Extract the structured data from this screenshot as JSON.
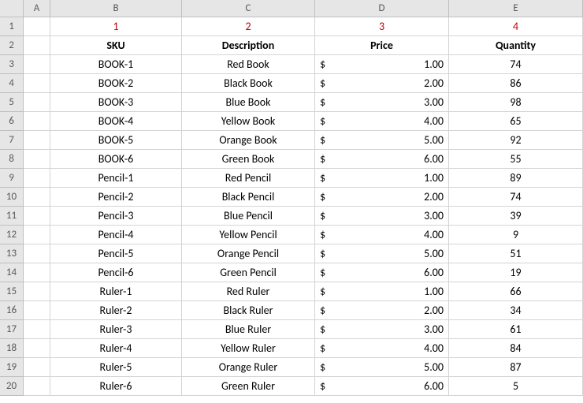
{
  "columns": [
    "A",
    "B",
    "C",
    "D",
    "E"
  ],
  "row_numbers": [
    "1",
    "2",
    "3",
    "4",
    "5",
    "6",
    "7",
    "8",
    "9",
    "10",
    "11",
    "12",
    "13",
    "14",
    "15",
    "16",
    "17",
    "18",
    "19",
    "20"
  ],
  "row1": {
    "B": "1",
    "C": "2",
    "D": "3",
    "E": "4"
  },
  "headers": {
    "B": "SKU",
    "C": "Description",
    "D": "Price",
    "E": "Quantity"
  },
  "currency_symbol": "$",
  "rows": [
    {
      "sku": "BOOK-1",
      "desc": "Red Book",
      "price": "1.00",
      "qty": "74"
    },
    {
      "sku": "BOOK-2",
      "desc": "Black Book",
      "price": "2.00",
      "qty": "86"
    },
    {
      "sku": "BOOK-3",
      "desc": "Blue Book",
      "price": "3.00",
      "qty": "98"
    },
    {
      "sku": "BOOK-4",
      "desc": "Yellow Book",
      "price": "4.00",
      "qty": "65"
    },
    {
      "sku": "BOOK-5",
      "desc": "Orange Book",
      "price": "5.00",
      "qty": "92"
    },
    {
      "sku": "BOOK-6",
      "desc": "Green Book",
      "price": "6.00",
      "qty": "55"
    },
    {
      "sku": "Pencil-1",
      "desc": "Red Pencil",
      "price": "1.00",
      "qty": "89"
    },
    {
      "sku": "Pencil-2",
      "desc": "Black Pencil",
      "price": "2.00",
      "qty": "74"
    },
    {
      "sku": "Pencil-3",
      "desc": "Blue Pencil",
      "price": "3.00",
      "qty": "39"
    },
    {
      "sku": "Pencil-4",
      "desc": "Yellow Pencil",
      "price": "4.00",
      "qty": "9"
    },
    {
      "sku": "Pencil-5",
      "desc": "Orange Pencil",
      "price": "5.00",
      "qty": "51"
    },
    {
      "sku": "Pencil-6",
      "desc": "Green Pencil",
      "price": "6.00",
      "qty": "19"
    },
    {
      "sku": "Ruler-1",
      "desc": "Red Ruler",
      "price": "1.00",
      "qty": "66"
    },
    {
      "sku": "Ruler-2",
      "desc": "Black Ruler",
      "price": "2.00",
      "qty": "34"
    },
    {
      "sku": "Ruler-3",
      "desc": "Blue Ruler",
      "price": "3.00",
      "qty": "61"
    },
    {
      "sku": "Ruler-4",
      "desc": "Yellow Ruler",
      "price": "4.00",
      "qty": "84"
    },
    {
      "sku": "Ruler-5",
      "desc": "Orange Ruler",
      "price": "5.00",
      "qty": "87"
    },
    {
      "sku": "Ruler-6",
      "desc": "Green Ruler",
      "price": "6.00",
      "qty": "5"
    }
  ]
}
